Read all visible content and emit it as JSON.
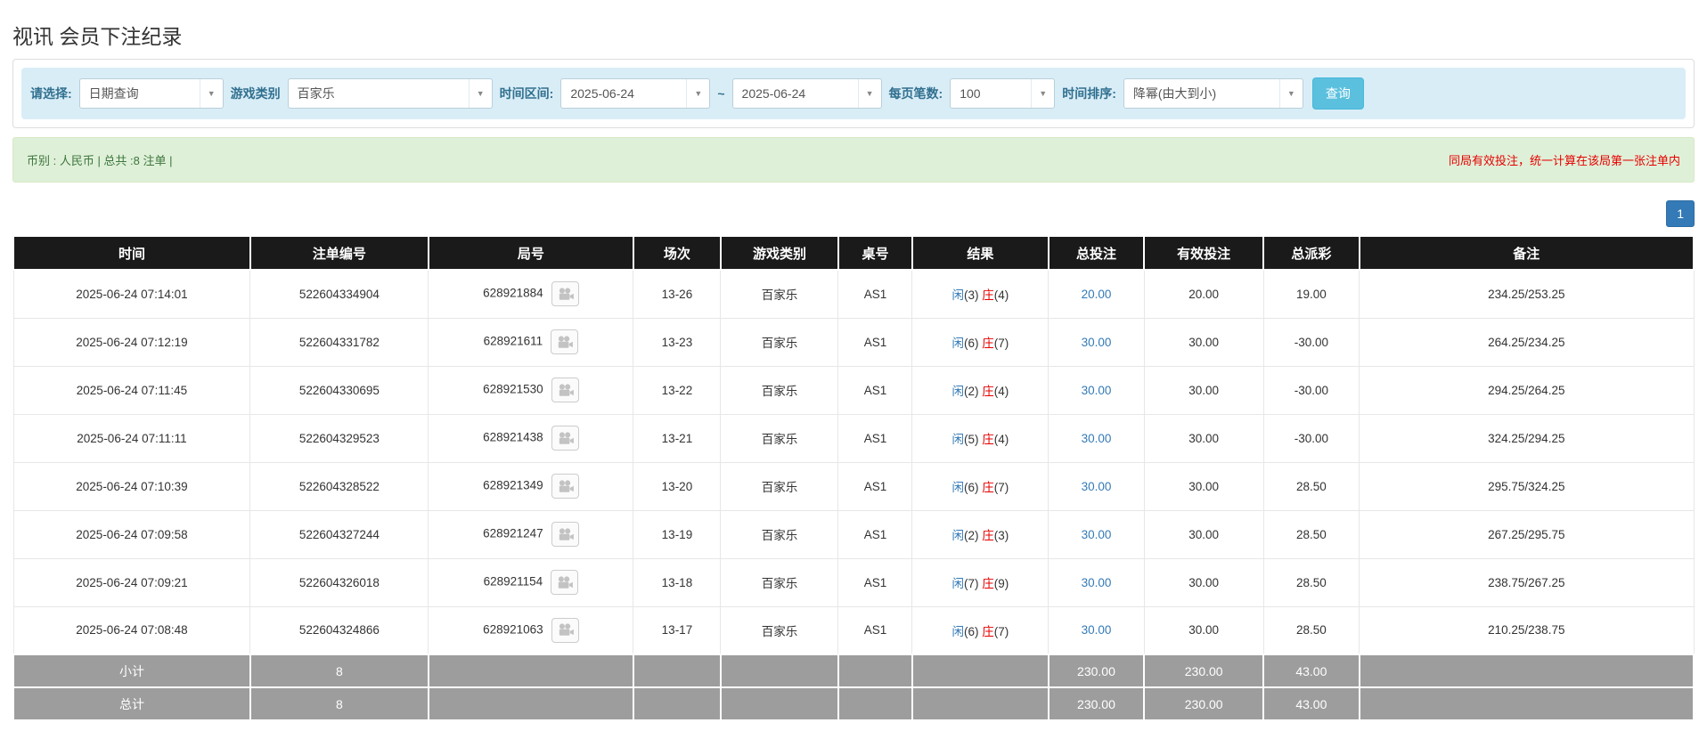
{
  "page": {
    "title": "视讯 会员下注纪录"
  },
  "filters": {
    "select_label": "请选择:",
    "select_value": "日期查询",
    "game_type_label": "游戏类别",
    "game_type_value": "百家乐",
    "time_range_label": "时间区间:",
    "date_from": "2025-06-24",
    "date_separator": "~",
    "date_to": "2025-06-24",
    "page_size_label": "每页笔数:",
    "page_size_value": "100",
    "sort_label": "时间排序:",
    "sort_value": "降幂(由大到小)",
    "search_button": "查询",
    "chevron": "▼"
  },
  "summary": {
    "left_text": "币别 : 人民币 | 总共 :8 注单 |",
    "right_text": "同局有效投注，统一计算在该局第一张注单内"
  },
  "pagination": {
    "current_page": "1"
  },
  "table": {
    "headers": [
      "时间",
      "注单编号",
      "局号",
      "场次",
      "游戏类别",
      "桌号",
      "结果",
      "总投注",
      "有效投注",
      "总派彩",
      "备注"
    ],
    "col_widths": [
      "14.1%",
      "10.6%",
      "12.2%",
      "5.2%",
      "7%",
      "4.4%",
      "8.1%",
      "5.7%",
      "7.1%",
      "5.7%",
      "19.9%"
    ],
    "rows": [
      {
        "time": "2025-06-24 07:14:01",
        "bet_id": "522604334904",
        "round_id": "628921884",
        "session": "13-26",
        "game": "百家乐",
        "table_no": "AS1",
        "player_label": "闲",
        "player_value": "(3)",
        "banker_label": "庄",
        "banker_value": "(4)",
        "total_bet": "20.00",
        "valid_bet": "20.00",
        "payout": "19.00",
        "note": "234.25/253.25"
      },
      {
        "time": "2025-06-24 07:12:19",
        "bet_id": "522604331782",
        "round_id": "628921611",
        "session": "13-23",
        "game": "百家乐",
        "table_no": "AS1",
        "player_label": "闲",
        "player_value": "(6)",
        "banker_label": "庄",
        "banker_value": "(7)",
        "total_bet": "30.00",
        "valid_bet": "30.00",
        "payout": "-30.00",
        "note": "264.25/234.25"
      },
      {
        "time": "2025-06-24 07:11:45",
        "bet_id": "522604330695",
        "round_id": "628921530",
        "session": "13-22",
        "game": "百家乐",
        "table_no": "AS1",
        "player_label": "闲",
        "player_value": "(2)",
        "banker_label": "庄",
        "banker_value": "(4)",
        "total_bet": "30.00",
        "valid_bet": "30.00",
        "payout": "-30.00",
        "note": "294.25/264.25"
      },
      {
        "time": "2025-06-24 07:11:11",
        "bet_id": "522604329523",
        "round_id": "628921438",
        "session": "13-21",
        "game": "百家乐",
        "table_no": "AS1",
        "player_label": "闲",
        "player_value": "(5)",
        "banker_label": "庄",
        "banker_value": "(4)",
        "total_bet": "30.00",
        "valid_bet": "30.00",
        "payout": "-30.00",
        "note": "324.25/294.25"
      },
      {
        "time": "2025-06-24 07:10:39",
        "bet_id": "522604328522",
        "round_id": "628921349",
        "session": "13-20",
        "game": "百家乐",
        "table_no": "AS1",
        "player_label": "闲",
        "player_value": "(6)",
        "banker_label": "庄",
        "banker_value": "(7)",
        "total_bet": "30.00",
        "valid_bet": "30.00",
        "payout": "28.50",
        "note": "295.75/324.25"
      },
      {
        "time": "2025-06-24 07:09:58",
        "bet_id": "522604327244",
        "round_id": "628921247",
        "session": "13-19",
        "game": "百家乐",
        "table_no": "AS1",
        "player_label": "闲",
        "player_value": "(2)",
        "banker_label": "庄",
        "banker_value": "(3)",
        "total_bet": "30.00",
        "valid_bet": "30.00",
        "payout": "28.50",
        "note": "267.25/295.75"
      },
      {
        "time": "2025-06-24 07:09:21",
        "bet_id": "522604326018",
        "round_id": "628921154",
        "session": "13-18",
        "game": "百家乐",
        "table_no": "AS1",
        "player_label": "闲",
        "player_value": "(7)",
        "banker_label": "庄",
        "banker_value": "(9)",
        "total_bet": "30.00",
        "valid_bet": "30.00",
        "payout": "28.50",
        "note": "238.75/267.25"
      },
      {
        "time": "2025-06-24 07:08:48",
        "bet_id": "522604324866",
        "round_id": "628921063",
        "session": "13-17",
        "game": "百家乐",
        "table_no": "AS1",
        "player_label": "闲",
        "player_value": "(6)",
        "banker_label": "庄",
        "banker_value": "(7)",
        "total_bet": "30.00",
        "valid_bet": "30.00",
        "payout": "28.50",
        "note": "210.25/238.75"
      }
    ],
    "footer": [
      {
        "label": "小计",
        "count": "8",
        "total_bet": "230.00",
        "valid_bet": "230.00",
        "payout": "43.00"
      },
      {
        "label": "总计",
        "count": "8",
        "total_bet": "230.00",
        "valid_bet": "230.00",
        "payout": "43.00"
      }
    ]
  },
  "colors": {
    "accent_blue": "#5bc0de",
    "link_blue": "#337ab7",
    "negative_red": "#e60000",
    "header_bg": "#1a1a1a",
    "footer_bg": "#9d9d9d",
    "filter_bar_bg": "#d9edf7",
    "summary_bar_bg": "#dff0d8",
    "summary_text_green": "#3c763d",
    "label_blue": "#31708f"
  }
}
